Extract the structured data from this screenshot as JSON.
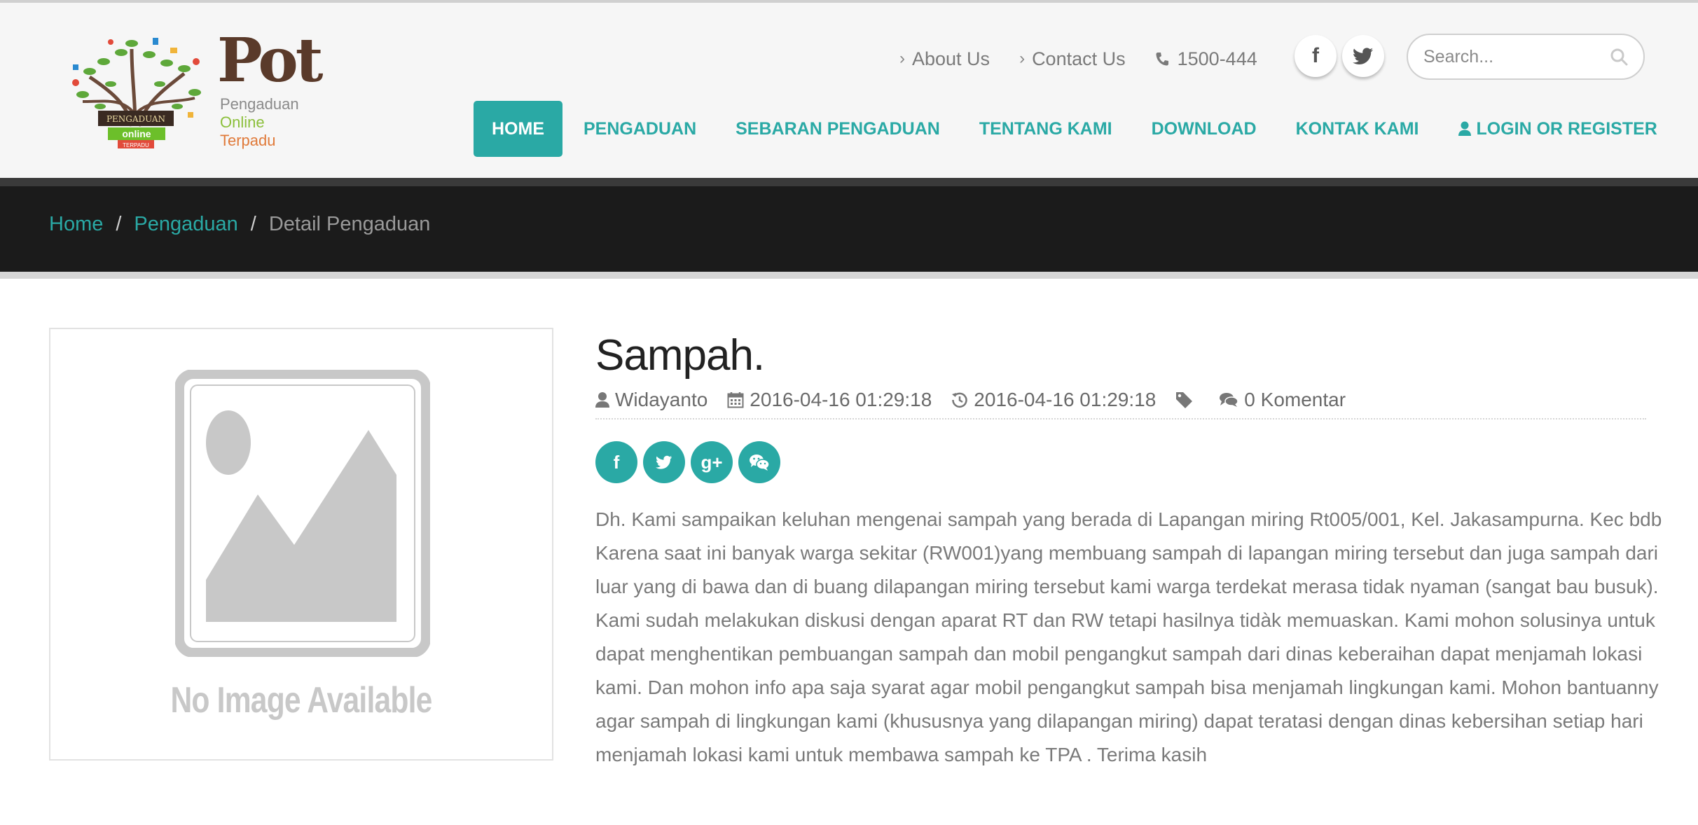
{
  "logo": {
    "brand": "Pot",
    "line1": "Pengaduan",
    "line2": "Online",
    "line3": "Terpadu"
  },
  "toplinks": {
    "about": "About Us",
    "contact": "Contact Us",
    "phone": "1500-444"
  },
  "social_top": {
    "facebook": "f",
    "twitter": "twitter"
  },
  "search": {
    "placeholder": "Search..."
  },
  "nav": {
    "items": [
      "HOME",
      "PENGADUAN",
      "SEBARAN PENGADUAN",
      "TENTANG KAMI",
      "DOWNLOAD",
      "KONTAK KAMI",
      "LOGIN OR REGISTER"
    ],
    "active": "HOME"
  },
  "breadcrumb": {
    "home": "Home",
    "section": "Pengaduan",
    "current": "Detail Pengaduan",
    "separator": "/"
  },
  "image": {
    "placeholder_text": "No Image Available"
  },
  "article": {
    "title": "Sampah.",
    "author": "Widayanto",
    "created": "2016-04-16 01:29:18",
    "updated": "2016-04-16 01:29:18",
    "comments": "0 Komentar",
    "body": "Dh. Kami sampaikan keluhan mengenai sampah yang berada di Lapangan miring Rt005/001, Kel. Jakasampurna. Kec bdb Karena saat ini banyak warga sekitar (RW001)yang membuang sampah di lapangan miring tersebut dan juga sampah dari luar yang di bawa dan di buang dilapangan miring tersebut kami warga terdekat merasa tidak nyaman (sangat bau busuk). Kami sudah melakukan diskusi dengan aparat RT dan RW tetapi hasilnya tidàk memuaskan. Kami mohon solusinya untuk dapat menghentikan pembuangan sampah dan mobil pengangkut sampah dari dinas keberaihan dapat menjamah lokasi kami. Dan mohon info apa saja syarat agar mobil pengangkut sampah bisa menjamah lingkungan kami. Mohon bantuanny agar sampah di lingkungan kami (khususnya yang dilapangan miring) dapat teratasi dengan dinas kebersihan setiap hari menjamah lokasi kami untuk membawa sampah ke TPA . Terima kasih"
  },
  "share": {
    "facebook": "f",
    "googleplus": "g+"
  },
  "colors": {
    "accent": "#2aa9a5",
    "band": "#1b1b1b",
    "header_bg": "#f6f6f6"
  },
  "icons": {
    "user": "user-icon",
    "calendar": "calendar-icon",
    "history": "history-icon",
    "tag": "tag-icon",
    "comments": "comments-icon",
    "phone": "phone-icon",
    "search": "search-icon"
  }
}
